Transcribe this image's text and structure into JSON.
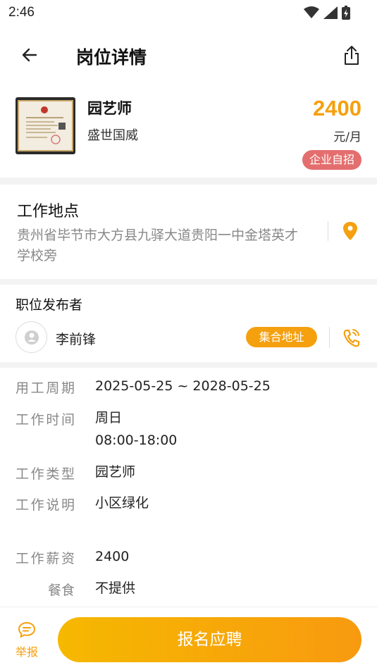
{
  "status_bar": {
    "time": "2:46"
  },
  "header": {
    "title": "岗位详情"
  },
  "job": {
    "name": "园艺师",
    "company": "盛世国威",
    "salary": "2400",
    "salary_unit": "元/月",
    "tag": "企业自招"
  },
  "location": {
    "title": "工作地点",
    "address": "贵州省毕节市大方县九驿大道贵阳一中金塔英才学校旁"
  },
  "publisher": {
    "title": "职位发布者",
    "name": "李前锋",
    "address_tag": "集合地址"
  },
  "details": [
    {
      "label": "用工周期",
      "value": "2025-05-25 ~ 2028-05-25"
    },
    {
      "label": "工作时间",
      "value": "周日",
      "value2": "08:00-18:00"
    },
    {
      "label": "工作类型",
      "value": "园艺师"
    },
    {
      "label": "工作说明",
      "value": "小区绿化"
    },
    {
      "label": "工作薪资",
      "value": "2400"
    },
    {
      "label": "餐食",
      "value": "不提供"
    }
  ],
  "bottom": {
    "report_label": "举报",
    "apply_label": "报名应聘"
  },
  "colors": {
    "accent": "#f5a00f",
    "tag_red": "#e46e6e"
  }
}
